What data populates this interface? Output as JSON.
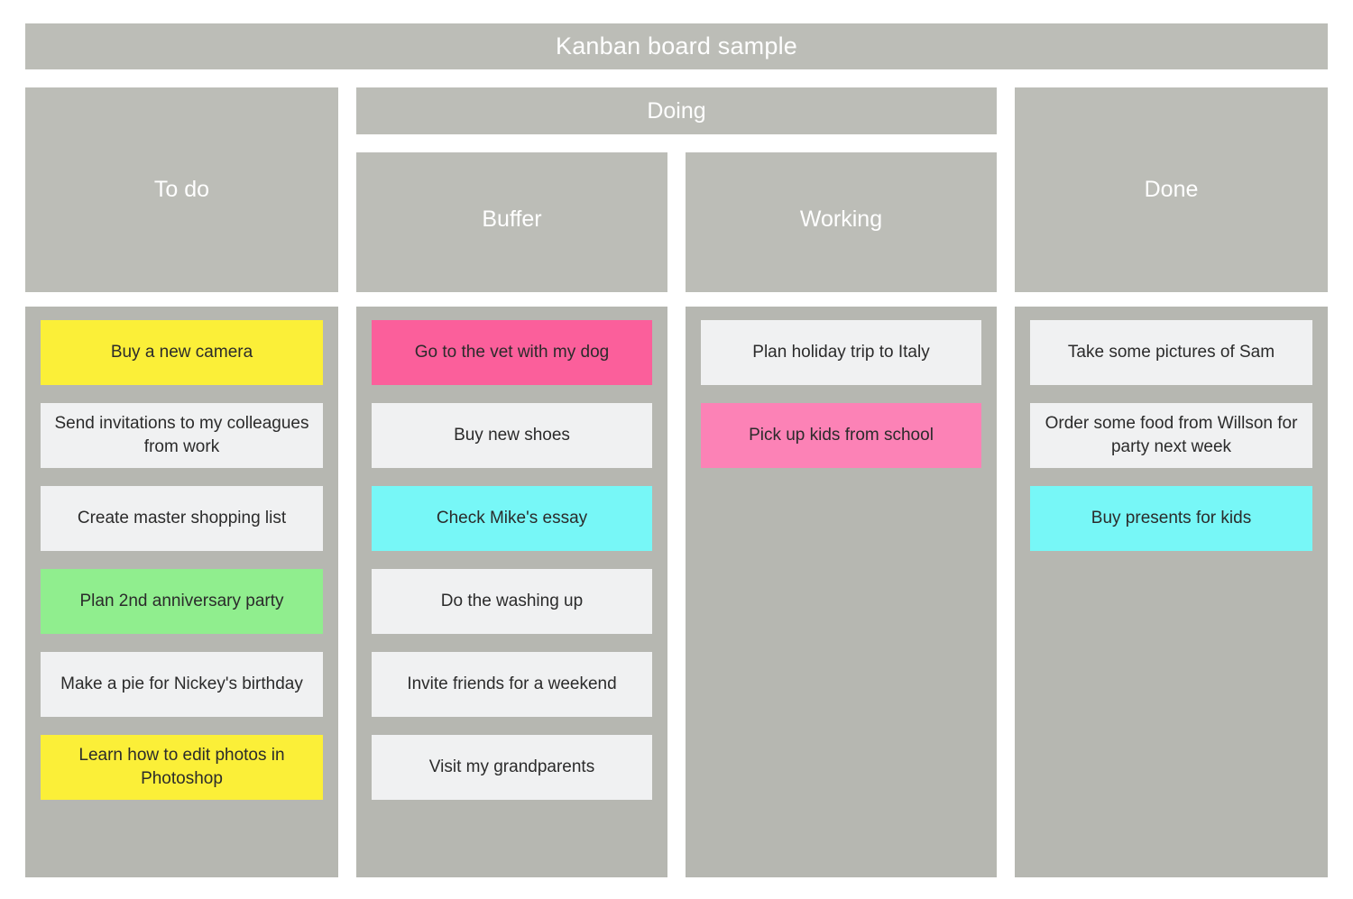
{
  "board": {
    "title": "Kanban board sample",
    "colors": {
      "header_bg": "#bcbdb7",
      "lane_bg": "#b6b7b1",
      "header_text": "#ffffff",
      "card_text": "#2b2b2b",
      "card_default": "#f0f1f2",
      "card_yellow": "#fbef38",
      "card_green": "#90ee8e",
      "card_cyan": "#77f7f7",
      "card_pink": "#fb5f9b",
      "card_pink_light": "#fc82b6",
      "page_bg": "#ffffff"
    },
    "headers": {
      "todo": "To do",
      "doing": "Doing",
      "buffer": "Buffer",
      "working": "Working",
      "done": "Done"
    },
    "columns": [
      {
        "id": "todo",
        "label": "To do",
        "cards": [
          {
            "text": "Buy a new camera",
            "color": "#fbef38"
          },
          {
            "text": "Send invitations to my colleagues from work",
            "color": "#f0f1f2"
          },
          {
            "text": "Create master shopping list",
            "color": "#f0f1f2"
          },
          {
            "text": "Plan 2nd anniversary party",
            "color": "#90ee8e"
          },
          {
            "text": "Make a pie for Nickey's birthday",
            "color": "#f0f1f2"
          },
          {
            "text": "Learn how to edit photos in Photoshop",
            "color": "#fbef38"
          }
        ]
      },
      {
        "id": "buffer",
        "label": "Buffer",
        "cards": [
          {
            "text": "Go to the vet with my dog",
            "color": "#fb5f9b"
          },
          {
            "text": "Buy new shoes",
            "color": "#f0f1f2"
          },
          {
            "text": "Check Mike's essay",
            "color": "#77f7f7"
          },
          {
            "text": "Do the washing up",
            "color": "#f0f1f2"
          },
          {
            "text": "Invite friends for a weekend",
            "color": "#f0f1f2"
          },
          {
            "text": "Visit my grandparents",
            "color": "#f0f1f2"
          }
        ]
      },
      {
        "id": "working",
        "label": "Working",
        "cards": [
          {
            "text": "Plan holiday trip to Italy",
            "color": "#f0f1f2"
          },
          {
            "text": "Pick up kids from school",
            "color": "#fc82b6"
          }
        ]
      },
      {
        "id": "done",
        "label": "Done",
        "cards": [
          {
            "text": "Take some pictures of Sam",
            "color": "#f0f1f2"
          },
          {
            "text": "Order some food from Willson for party next week",
            "color": "#f0f1f2"
          },
          {
            "text": "Buy presents for kids",
            "color": "#77f7f7"
          }
        ]
      }
    ]
  }
}
